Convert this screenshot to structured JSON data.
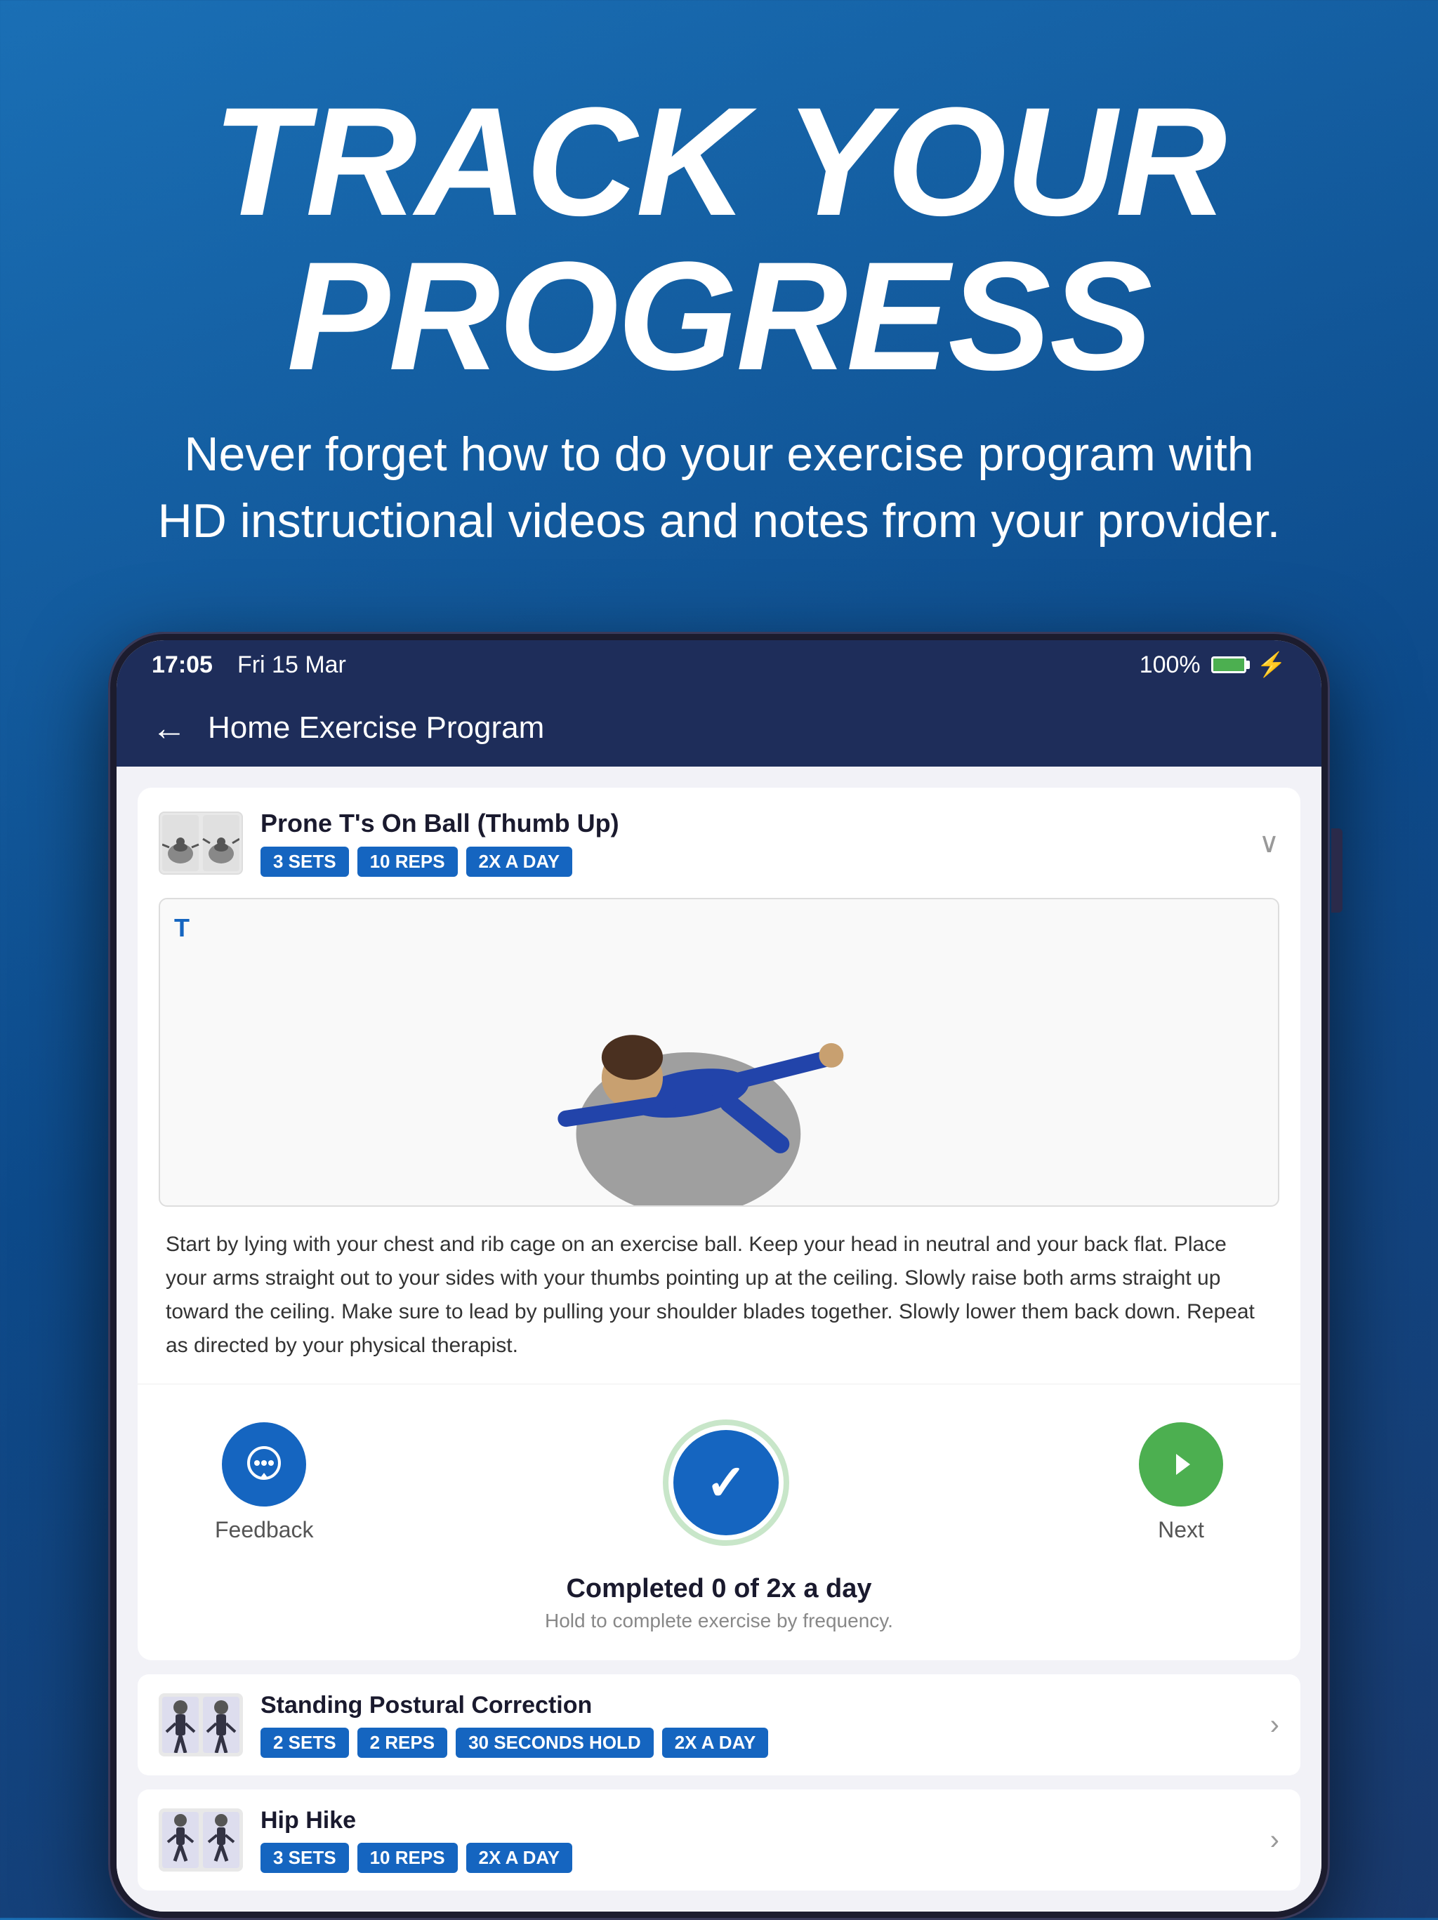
{
  "hero": {
    "title": "TRACK YOUR PROGRESS",
    "subtitle": "Never forget how to do your exercise program with HD instructional videos and notes from your provider."
  },
  "status_bar": {
    "time": "17:05",
    "date": "Fri 15 Mar",
    "battery": "100%"
  },
  "app_bar": {
    "title": "Home Exercise Program",
    "back_label": "←"
  },
  "exercise": {
    "name": "Prone T's On Ball (Thumb Up)",
    "tags": [
      "3 SETS",
      "10 REPS",
      "2X A DAY"
    ],
    "description": "Start by lying with your chest and rib cage on an exercise ball. Keep your head in neutral and your back flat. Place your arms straight out to your sides with your thumbs pointing up at the ceiling. Slowly raise both arms straight up toward the ceiling. Make sure to lead by pulling your shoulder blades together. Slowly lower them back down. Repeat as directed by your physical therapist."
  },
  "actions": {
    "feedback_label": "Feedback",
    "next_label": "Next",
    "completed_title": "Completed 0 of 2x a day",
    "completed_sub": "Hold to complete exercise by frequency."
  },
  "exercise_list": [
    {
      "name": "Standing Postural Correction",
      "tags": [
        "2 SETS",
        "2 REPS",
        "30 SECONDS HOLD",
        "2X A DAY"
      ]
    },
    {
      "name": "Hip Hike",
      "tags": [
        "3 SETS",
        "10 REPS",
        "2X A DAY"
      ]
    }
  ]
}
